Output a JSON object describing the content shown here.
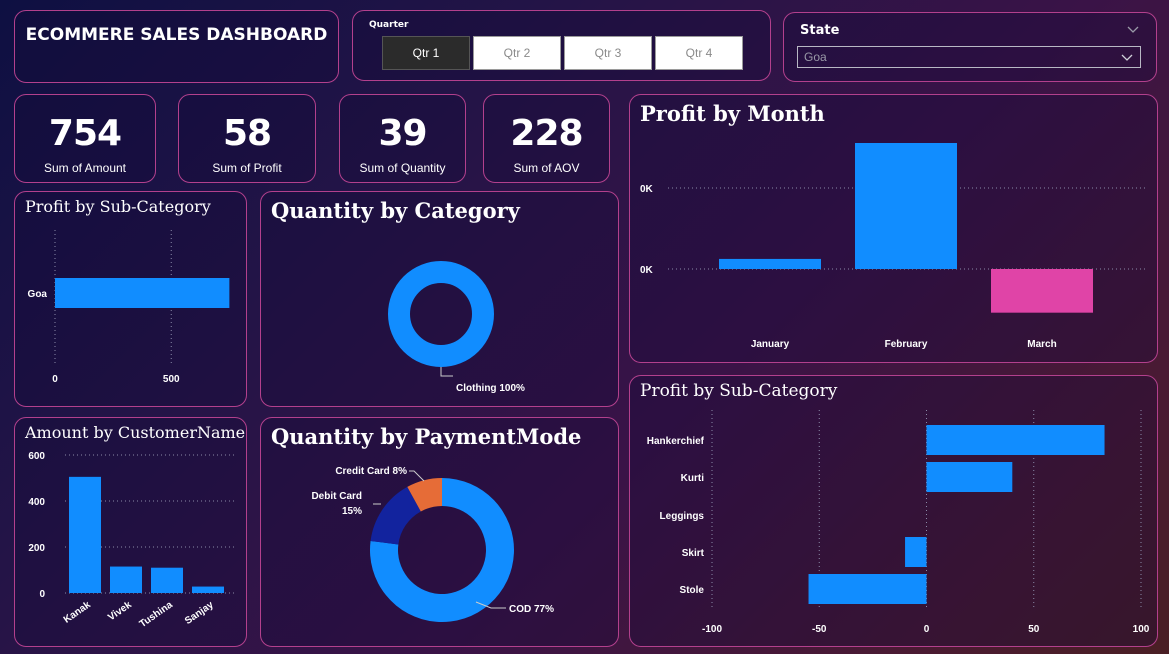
{
  "header": {
    "title": "ECOMMERE SALES DASHBOARD"
  },
  "quarter_slicer": {
    "label": "Quarter",
    "options": [
      "Qtr 1",
      "Qtr 2",
      "Qtr 3",
      "Qtr 4"
    ],
    "selected": "Qtr 1"
  },
  "state_slicer": {
    "label": "State",
    "selected": "Goa"
  },
  "kpis": [
    {
      "value": "754",
      "label": "Sum of Amount"
    },
    {
      "value": "58",
      "label": "Sum of Profit"
    },
    {
      "value": "39",
      "label": "Sum of Quantity"
    },
    {
      "value": "228",
      "label": "Sum of AOV"
    }
  ],
  "colors": {
    "accent": "#118dff",
    "negative": "#e044a7",
    "orange": "#e66c37",
    "navy": "#12239e",
    "border": "#b3408d"
  },
  "chart_data": [
    {
      "id": "profit_by_subcategory_state",
      "type": "bar",
      "orientation": "horizontal",
      "title": "Profit by Sub-Category",
      "categories": [
        "Goa"
      ],
      "values": [
        750
      ],
      "xticks": [
        0,
        500
      ],
      "xlim": [
        0,
        800
      ],
      "grid": true
    },
    {
      "id": "quantity_by_category",
      "type": "pie",
      "donut": true,
      "title": "Quantity by Category",
      "labels": [
        "Clothing 100%"
      ],
      "values": [
        100
      ]
    },
    {
      "id": "amount_by_customer",
      "type": "bar",
      "title": "Amount by CustomerName",
      "categories": [
        "Kanak",
        "Vivek",
        "Tushina",
        "Sanjay"
      ],
      "values": [
        505,
        115,
        110,
        28
      ],
      "yticks": [
        0,
        200,
        400,
        600
      ],
      "ylim": [
        0,
        600
      ],
      "grid": true
    },
    {
      "id": "quantity_by_paymentmode",
      "type": "pie",
      "donut": true,
      "title": "Quantity by PaymentMode",
      "slices": [
        {
          "name": "COD",
          "value": 77,
          "label": "COD 77%"
        },
        {
          "name": "Debit Card",
          "value": 15,
          "label_line1": "Debit Card",
          "label_line2": "15%"
        },
        {
          "name": "Credit Card",
          "value": 8,
          "label": "Credit Card 8%"
        }
      ]
    },
    {
      "id": "profit_by_month",
      "type": "bar",
      "title": "Profit by Month",
      "categories": [
        "January",
        "February",
        "March"
      ],
      "values": [
        12,
        150,
        -52
      ],
      "yticks": [
        0,
        0
      ],
      "ytick_labels": [
        "0K",
        "0K"
      ],
      "ylim": [
        -70,
        150
      ],
      "grid": true
    },
    {
      "id": "profit_by_subcategory",
      "type": "bar",
      "orientation": "horizontal",
      "title": "Profit by Sub-Category",
      "categories": [
        "Hankerchief",
        "Kurti",
        "Leggings",
        "Skirt",
        "Stole"
      ],
      "values": [
        83,
        40,
        0,
        -10,
        -55
      ],
      "xticks": [
        -100,
        -50,
        0,
        50,
        100
      ],
      "xlim": [
        -100,
        100
      ],
      "grid": true
    }
  ]
}
